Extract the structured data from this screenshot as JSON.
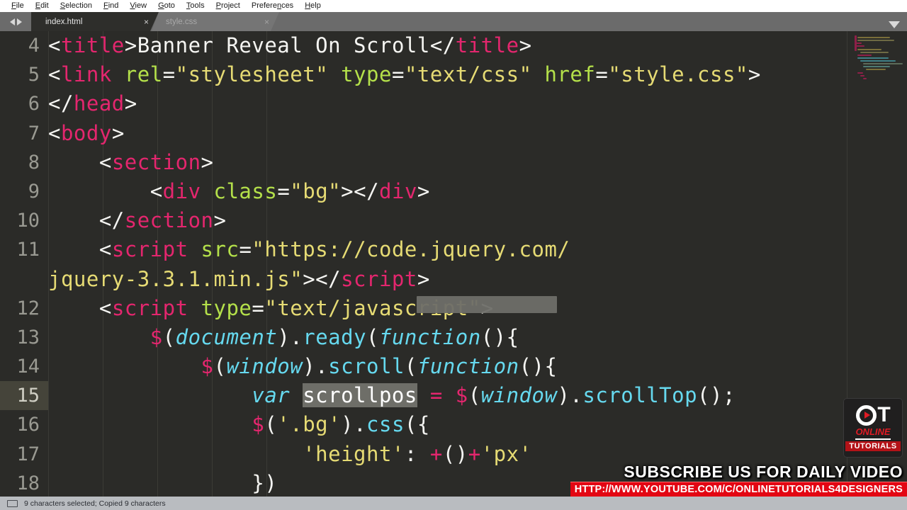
{
  "menu": {
    "items": [
      {
        "label": "File",
        "mnemonic": "F"
      },
      {
        "label": "Edit",
        "mnemonic": "E"
      },
      {
        "label": "Selection",
        "mnemonic": "S"
      },
      {
        "label": "Find",
        "mnemonic": "F"
      },
      {
        "label": "View",
        "mnemonic": "V"
      },
      {
        "label": "Goto",
        "mnemonic": "G"
      },
      {
        "label": "Tools",
        "mnemonic": "T"
      },
      {
        "label": "Project",
        "mnemonic": "P"
      },
      {
        "label": "Preferences",
        "mnemonic": "n"
      },
      {
        "label": "Help",
        "mnemonic": "H"
      }
    ]
  },
  "tabs": {
    "nav_prev_icon": "arrow-left-icon",
    "nav_next_icon": "arrow-right-icon",
    "close_glyph": "×",
    "dropdown_icon": "chevron-down-icon",
    "items": [
      {
        "label": "index.html",
        "active": true
      },
      {
        "label": "style.css",
        "active": false
      }
    ]
  },
  "editor": {
    "active_line": 15,
    "first_visible_line": 4,
    "selection_text": "scrollpos",
    "lines": [
      {
        "num": "4",
        "indent": 0,
        "tokens": [
          {
            "t": "<",
            "c": "punc"
          },
          {
            "t": "title",
            "c": "tag"
          },
          {
            "t": ">",
            "c": "punc"
          },
          {
            "t": "Banner Reveal On Scroll",
            "c": "txt"
          },
          {
            "t": "</",
            "c": "punc"
          },
          {
            "t": "title",
            "c": "tag"
          },
          {
            "t": ">",
            "c": "punc"
          }
        ]
      },
      {
        "num": "5",
        "indent": 0,
        "tokens": [
          {
            "t": "<",
            "c": "punc"
          },
          {
            "t": "link",
            "c": "tag"
          },
          {
            "t": " ",
            "c": "txt"
          },
          {
            "t": "rel",
            "c": "attr"
          },
          {
            "t": "=",
            "c": "punc"
          },
          {
            "t": "\"stylesheet\"",
            "c": "str"
          },
          {
            "t": " ",
            "c": "txt"
          },
          {
            "t": "type",
            "c": "attr"
          },
          {
            "t": "=",
            "c": "punc"
          },
          {
            "t": "\"text/css\"",
            "c": "str"
          },
          {
            "t": " ",
            "c": "txt"
          },
          {
            "t": "href",
            "c": "attr"
          },
          {
            "t": "=",
            "c": "punc"
          },
          {
            "t": "\"style.css\"",
            "c": "str"
          },
          {
            "t": ">",
            "c": "punc"
          }
        ]
      },
      {
        "num": "6",
        "indent": 0,
        "tokens": [
          {
            "t": "</",
            "c": "punc"
          },
          {
            "t": "head",
            "c": "tag"
          },
          {
            "t": ">",
            "c": "punc"
          }
        ]
      },
      {
        "num": "7",
        "indent": 0,
        "tokens": [
          {
            "t": "<",
            "c": "punc"
          },
          {
            "t": "body",
            "c": "tag"
          },
          {
            "t": ">",
            "c": "punc"
          }
        ]
      },
      {
        "num": "8",
        "indent": 1,
        "tokens": [
          {
            "t": "    ",
            "c": "txt"
          },
          {
            "t": "<",
            "c": "punc"
          },
          {
            "t": "section",
            "c": "tag"
          },
          {
            "t": ">",
            "c": "punc"
          }
        ]
      },
      {
        "num": "9",
        "indent": 2,
        "tokens": [
          {
            "t": "        ",
            "c": "txt"
          },
          {
            "t": "<",
            "c": "punc"
          },
          {
            "t": "div",
            "c": "tag"
          },
          {
            "t": " ",
            "c": "txt"
          },
          {
            "t": "class",
            "c": "attr"
          },
          {
            "t": "=",
            "c": "punc"
          },
          {
            "t": "\"bg\"",
            "c": "str"
          },
          {
            "t": ">",
            "c": "punc"
          },
          {
            "t": "</",
            "c": "punc"
          },
          {
            "t": "div",
            "c": "tag"
          },
          {
            "t": ">",
            "c": "punc"
          }
        ]
      },
      {
        "num": "10",
        "indent": 1,
        "tokens": [
          {
            "t": "    ",
            "c": "txt"
          },
          {
            "t": "</",
            "c": "punc"
          },
          {
            "t": "section",
            "c": "tag"
          },
          {
            "t": ">",
            "c": "punc"
          }
        ]
      },
      {
        "num": "11",
        "indent": 1,
        "tokens": [
          {
            "t": "    ",
            "c": "txt"
          },
          {
            "t": "<",
            "c": "punc"
          },
          {
            "t": "script",
            "c": "tag"
          },
          {
            "t": " ",
            "c": "txt"
          },
          {
            "t": "src",
            "c": "attr"
          },
          {
            "t": "=",
            "c": "punc"
          },
          {
            "t": "\"https://code.jquery.com/",
            "c": "str"
          }
        ]
      },
      {
        "num": "",
        "indent": 0,
        "wrapped": true,
        "tokens": [
          {
            "t": "jquery-3.3.1.min.js\"",
            "c": "str"
          },
          {
            "t": "></",
            "c": "punc"
          },
          {
            "t": "script",
            "c": "tag"
          },
          {
            "t": ">",
            "c": "punc"
          }
        ]
      },
      {
        "num": "12",
        "indent": 1,
        "tokens": [
          {
            "t": "    ",
            "c": "txt"
          },
          {
            "t": "<",
            "c": "punc"
          },
          {
            "t": "script",
            "c": "tag"
          },
          {
            "t": " ",
            "c": "txt"
          },
          {
            "t": "type",
            "c": "attr"
          },
          {
            "t": "=",
            "c": "punc"
          },
          {
            "t": "\"text/javascript\"",
            "c": "str"
          },
          {
            "t": ">",
            "c": "punc"
          }
        ]
      },
      {
        "num": "13",
        "indent": 2,
        "tokens": [
          {
            "t": "        ",
            "c": "txt"
          },
          {
            "t": "$",
            "c": "dollar"
          },
          {
            "t": "(",
            "c": "punc"
          },
          {
            "t": "document",
            "c": "kw"
          },
          {
            "t": ").",
            "c": "punc"
          },
          {
            "t": "ready",
            "c": "meth"
          },
          {
            "t": "(",
            "c": "punc"
          },
          {
            "t": "function",
            "c": "kw"
          },
          {
            "t": "(){",
            "c": "punc"
          }
        ]
      },
      {
        "num": "14",
        "indent": 3,
        "tokens": [
          {
            "t": "            ",
            "c": "txt"
          },
          {
            "t": "$",
            "c": "dollar"
          },
          {
            "t": "(",
            "c": "punc"
          },
          {
            "t": "window",
            "c": "kw"
          },
          {
            "t": ").",
            "c": "punc"
          },
          {
            "t": "scroll",
            "c": "meth"
          },
          {
            "t": "(",
            "c": "punc"
          },
          {
            "t": "function",
            "c": "kw"
          },
          {
            "t": "(){",
            "c": "punc"
          }
        ]
      },
      {
        "num": "15",
        "indent": 4,
        "highlight": true,
        "tokens": [
          {
            "t": "                ",
            "c": "txt"
          },
          {
            "t": "var",
            "c": "kw"
          },
          {
            "t": " ",
            "c": "txt"
          },
          {
            "t": "scrollpos",
            "c": "sel"
          },
          {
            "t": " ",
            "c": "txt"
          },
          {
            "t": "=",
            "c": "op"
          },
          {
            "t": " ",
            "c": "txt"
          },
          {
            "t": "$",
            "c": "dollar"
          },
          {
            "t": "(",
            "c": "punc"
          },
          {
            "t": "window",
            "c": "kw"
          },
          {
            "t": ").",
            "c": "punc"
          },
          {
            "t": "scrollTop",
            "c": "meth"
          },
          {
            "t": "();",
            "c": "punc"
          }
        ]
      },
      {
        "num": "16",
        "indent": 4,
        "tokens": [
          {
            "t": "                ",
            "c": "txt"
          },
          {
            "t": "$",
            "c": "dollar"
          },
          {
            "t": "(",
            "c": "punc"
          },
          {
            "t": "'.bg'",
            "c": "str"
          },
          {
            "t": ").",
            "c": "punc"
          },
          {
            "t": "css",
            "c": "meth"
          },
          {
            "t": "({",
            "c": "punc"
          }
        ]
      },
      {
        "num": "17",
        "indent": 5,
        "tokens": [
          {
            "t": "                    ",
            "c": "txt"
          },
          {
            "t": "'height'",
            "c": "str"
          },
          {
            "t": ": ",
            "c": "punc"
          },
          {
            "t": "+",
            "c": "op"
          },
          {
            "t": "()",
            "c": "punc"
          },
          {
            "t": "+",
            "c": "op"
          },
          {
            "t": "'px'",
            "c": "str"
          }
        ]
      },
      {
        "num": "18",
        "indent": 4,
        "tokens": [
          {
            "t": "                ",
            "c": "txt"
          },
          {
            "t": "})",
            "c": "punc"
          }
        ]
      }
    ]
  },
  "statusbar": {
    "icon": "monitor-icon",
    "text": "9 characters selected; Copied 9 characters"
  },
  "branding": {
    "logo_initials_o": "O",
    "logo_initials_t": "T",
    "logo_online": "ONLINE",
    "logo_tutorials": "TUTORIALS",
    "subscribe": "SUBSCRIBE US FOR DAILY VIDEO",
    "url": "HTTP://WWW.YOUTUBE.COM/C/ONLINETUTORIALS4DESIGNERS"
  },
  "colors": {
    "editor_bg": "#2b2b28",
    "tag": "#e4266e",
    "attribute": "#b4e04a",
    "string": "#e6db74",
    "keyword": "#66d9ef",
    "accent_red": "#e30613",
    "selection": "#6e6e68",
    "active_line": "#45443a"
  }
}
